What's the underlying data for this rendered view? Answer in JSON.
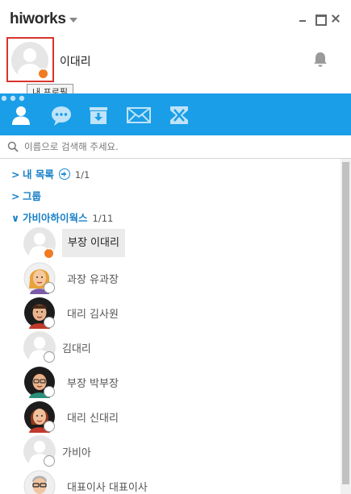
{
  "app": {
    "brand_prefix": "h",
    "brand_rest": "iworks",
    "brand_dot_color": "#d9342b",
    "accent_color": "#1a9ee8"
  },
  "window_controls": [
    "minimize-icon",
    "maximize-icon",
    "close-icon"
  ],
  "profile": {
    "name": "이대리",
    "status": "busy",
    "tooltip": "내 프로필"
  },
  "toolbar": {
    "icons": [
      "people-icon",
      "chat-icon",
      "inbox-icon",
      "mail-icon",
      "approval-icon",
      "more-icon"
    ]
  },
  "search": {
    "placeholder": "이름으로 검색해 주세요."
  },
  "groups": [
    {
      "label": "내 목록",
      "count": "1/1",
      "expanded": false
    },
    {
      "label": "그룹",
      "count": "",
      "expanded": false
    },
    {
      "label": "가비아하이웍스",
      "count": "1/11",
      "expanded": true
    }
  ],
  "members": [
    {
      "name": "부장 이대리",
      "status": "busy",
      "selected": true
    },
    {
      "name": "과장 유과장",
      "status": "offline"
    },
    {
      "name": "대리 김사원",
      "status": "offline"
    },
    {
      "name": "김대리",
      "status": "offline"
    },
    {
      "name": "부장 박부장",
      "status": "offline"
    },
    {
      "name": "대리 신대리",
      "status": "offline"
    },
    {
      "name": "가비아",
      "status": "offline"
    },
    {
      "name": "대표이사 대표이사",
      "status": "offline"
    }
  ]
}
